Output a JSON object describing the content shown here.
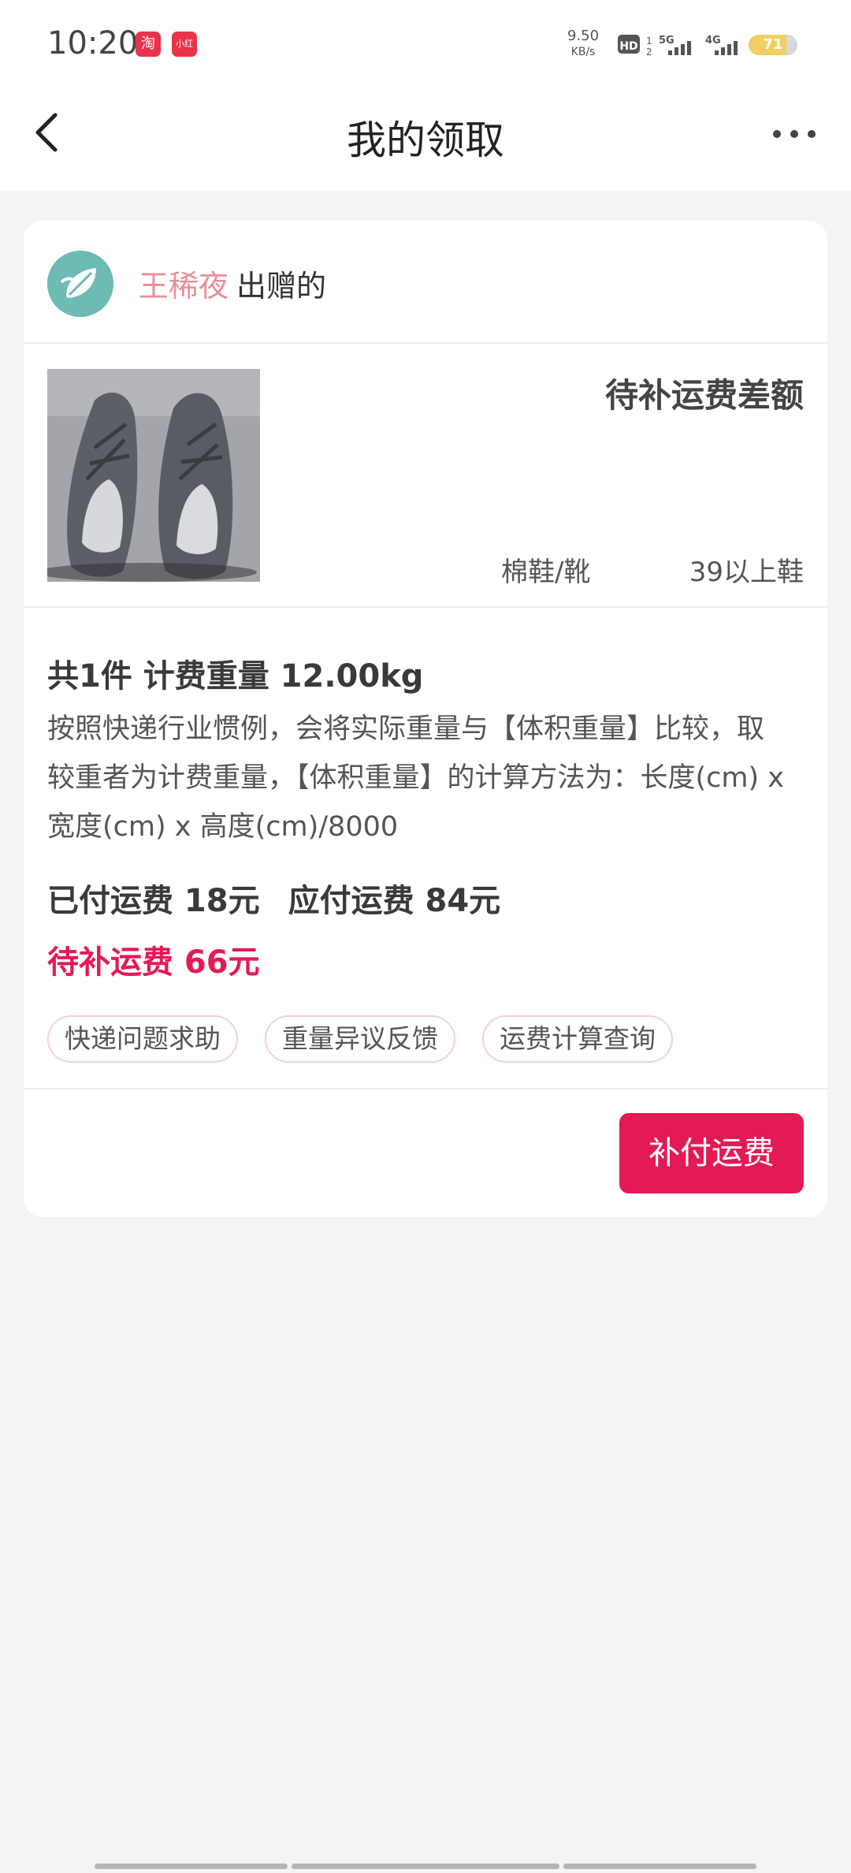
{
  "status_bar": {
    "time": "10:20",
    "app_icons": [
      "taobao-icon",
      "xiaohongshu-icon"
    ],
    "taobao_label": "淘",
    "xhs_label": "小红书",
    "net_speed_value": "9.50",
    "net_speed_unit": "KB/s",
    "battery_level": "71",
    "icons": [
      "hd-icon",
      "signal-5g-icon",
      "signal-4g-icon",
      "battery-icon"
    ]
  },
  "header": {
    "title": "我的领取",
    "back_icon": "chevron-left-icon",
    "more_icon": "more-dots-icon"
  },
  "card": {
    "giver_name": "王稀夜",
    "giver_suffix": "出赠的",
    "status_title": "待补运费差额",
    "category": "棉鞋/靴",
    "size": "39以上鞋",
    "summary": "共1件 计费重量 12.00kg",
    "explain": "按照快递行业惯例，会将实际重量与【体积重量】比较，取较重者为计费重量，【体积重量】的计算方法为：长度(cm) x 宽度(cm) x 高度(cm)/8000",
    "paid": "已付运费 18元",
    "due": "应付运费 84元",
    "pending": "待补运费 66元",
    "tags": [
      "快递问题求助",
      "重量异议反馈",
      "运费计算查询"
    ],
    "pay_button": "补付运费"
  },
  "colors": {
    "accent": "#e41a55",
    "giver_name": "#ea8f97",
    "avatar_bg": "#6cbbb4",
    "page_bg": "#f4f4f5"
  }
}
